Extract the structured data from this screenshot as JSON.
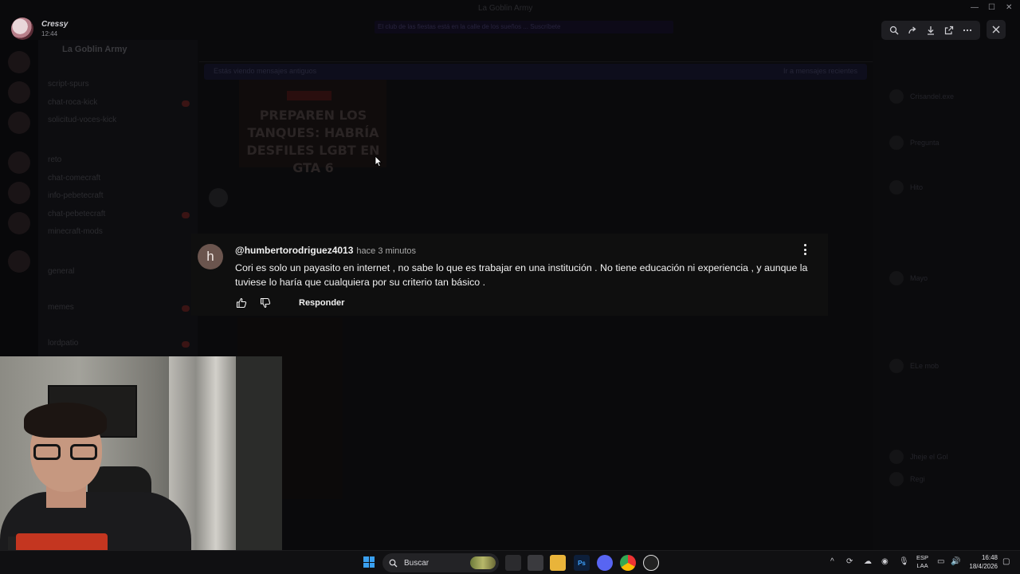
{
  "window": {
    "title": "La Goblin Army"
  },
  "viewer": {
    "user_name": "Cressy",
    "time": "12:44"
  },
  "background": {
    "guild_name": "La Goblin Army",
    "notice": "El club de las fiestas está en la calle de los sueños ... Suscríbete",
    "banner_left": "Estás viendo mensajes antiguos",
    "banner_right": "Ir a mensajes recientes",
    "thumbnail_text": "PREPAREN LOS TANQUES: HABRÍA DESFILES LGBT EN GTA 6",
    "channels": [
      "script-spurs",
      "chat-roca-kick",
      "solicitud-voces-kick",
      "reto",
      "chat-comecraft",
      "info-pebetecraft",
      "chat-pebetecraft",
      "minecraft-mods",
      "general",
      "memes",
      "lordpatio"
    ],
    "members": [
      "Crisandel.exe",
      "Pregunta",
      "Hito",
      "Mayo",
      "ELe mob",
      "Jheje el Gol",
      "Regi"
    ]
  },
  "comment": {
    "avatar_letter": "h",
    "handle": "@humbertorodriguez4013",
    "time": "hace 3 minutos",
    "text": "Cori es solo un payasito en internet , no sabe lo que es trabajar en una institución . No tiene educación ni experiencia , y aunque la tuviese lo haría que cualquiera por su criterio tan básico .",
    "reply_label": "Responder"
  },
  "taskbar": {
    "search_label": "Buscar",
    "lang_line1": "ESP",
    "lang_line2": "LAA",
    "time": "16:48",
    "date": "18/4/2026",
    "apps": [
      "file-explorer",
      "photoshop",
      "discord",
      "chrome",
      "obs"
    ]
  }
}
